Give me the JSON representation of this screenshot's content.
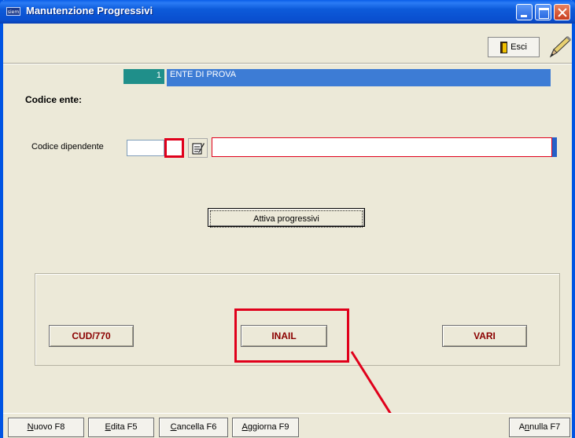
{
  "window": {
    "app_icon_text": "siem",
    "title": "Manutenzione Progressivi"
  },
  "toolbar": {
    "esci_label": "Esci"
  },
  "ente": {
    "label": "Codice ente:",
    "code": "1",
    "name": "ENTE DI PROVA"
  },
  "dipendente": {
    "label": "Codice dipendente",
    "code_value": "",
    "name_value": ""
  },
  "attiva_button": "Attiva progressivi",
  "group_buttons": {
    "cud": "CUD/770",
    "inail": "INAIL",
    "vari": "VARI"
  },
  "bottom_buttons": {
    "nuovo": {
      "hotkey": "N",
      "rest": "uovo F8"
    },
    "edita": {
      "hotkey": "E",
      "rest": "dita F5"
    },
    "cancella": {
      "hotkey": "C",
      "rest": "ancella F6"
    },
    "aggiorna": {
      "hotkey": "A",
      "rest": "ggiorna F9"
    },
    "annulla": {
      "prefix": "A",
      "hotkey": "n",
      "rest": "nulla F7"
    }
  },
  "colors": {
    "titlebar": "#0a5ee8",
    "ente_code_bg": "#1f8f8a",
    "ente_name_bg": "#3d7cd5",
    "annotation_red": "#e0001b",
    "button_text": "#8b0000"
  }
}
